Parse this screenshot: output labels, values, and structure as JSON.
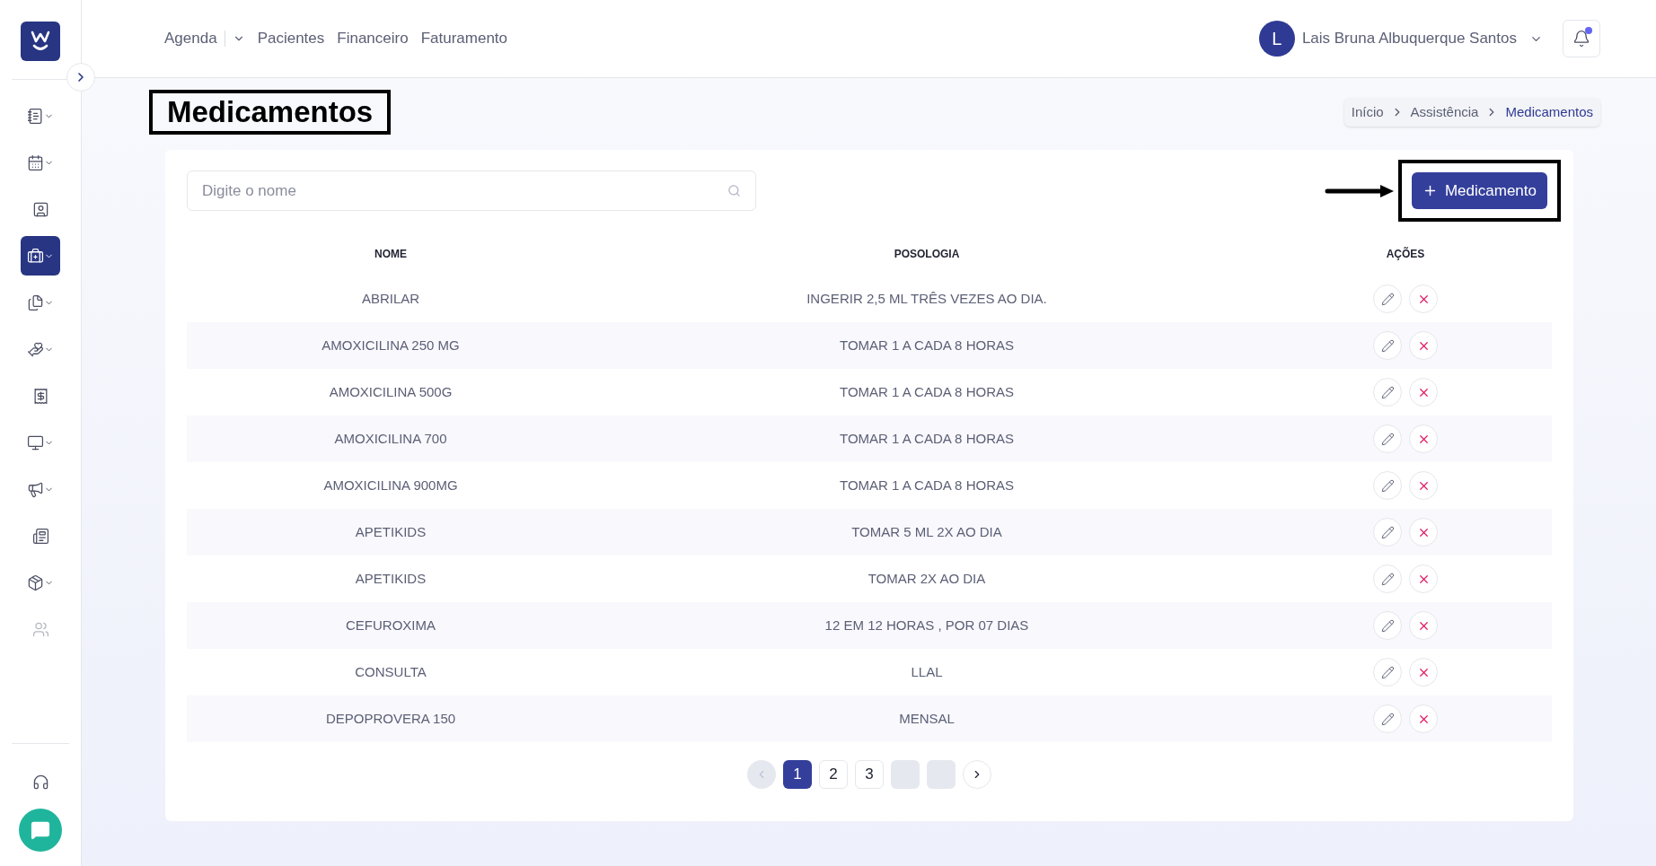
{
  "sidebar": {
    "items": [
      {
        "has_caret": true,
        "selected": false,
        "disabled": false
      },
      {
        "has_caret": true,
        "selected": false,
        "disabled": false
      },
      {
        "has_caret": false,
        "selected": false,
        "disabled": false
      },
      {
        "has_caret": true,
        "selected": true,
        "disabled": false
      },
      {
        "has_caret": true,
        "selected": false,
        "disabled": false
      },
      {
        "has_caret": true,
        "selected": false,
        "disabled": false
      },
      {
        "has_caret": false,
        "selected": false,
        "disabled": false
      },
      {
        "has_caret": true,
        "selected": false,
        "disabled": false
      },
      {
        "has_caret": true,
        "selected": false,
        "disabled": false
      },
      {
        "has_caret": false,
        "selected": false,
        "disabled": false
      },
      {
        "has_caret": true,
        "selected": false,
        "disabled": false
      },
      {
        "has_caret": false,
        "selected": false,
        "disabled": true
      }
    ]
  },
  "topbar": {
    "nav": [
      {
        "label": "Agenda",
        "has_dropdown": true
      },
      {
        "label": "Pacientes",
        "has_dropdown": false
      },
      {
        "label": "Financeiro",
        "has_dropdown": false
      },
      {
        "label": "Faturamento",
        "has_dropdown": false
      }
    ],
    "user": {
      "initial": "L",
      "name": "Lais Bruna Albuquerque Santos"
    },
    "notifications": {
      "unread": true
    }
  },
  "page": {
    "title": "Medicamentos",
    "breadcrumb": [
      {
        "label": "Início",
        "selected": false
      },
      {
        "label": "Assistência",
        "selected": false
      },
      {
        "label": "Medicamentos",
        "selected": true
      }
    ]
  },
  "search": {
    "placeholder": "Digite o nome"
  },
  "add_button": "Medicamento",
  "table": {
    "columns": [
      "NOME",
      "POSOLOGIA",
      "AÇÕES"
    ],
    "rows": [
      {
        "nome": "ABRILAR",
        "posologia": "INGERIR 2,5 ML TRÊS VEZES AO DIA."
      },
      {
        "nome": "AMOXICILINA 250 MG",
        "posologia": "TOMAR 1 A CADA 8 HORAS"
      },
      {
        "nome": "AMOXICILINA 500G",
        "posologia": "TOMAR 1 A CADA 8 HORAS"
      },
      {
        "nome": "AMOXICILINA 700",
        "posologia": "TOMAR 1 A CADA 8 HORAS"
      },
      {
        "nome": "AMOXICILINA 900MG",
        "posologia": "TOMAR 1 A CADA 8 HORAS"
      },
      {
        "nome": "APETIKIDS",
        "posologia": "TOMAR 5 ML 2X AO DIA"
      },
      {
        "nome": "APETIKIDS",
        "posologia": "TOMAR 2X AO DIA"
      },
      {
        "nome": "CEFUROXIMA",
        "posologia": "12 EM 12 HORAS , POR 07 DIAS"
      },
      {
        "nome": "CONSULTA",
        "posologia": "LLAL"
      },
      {
        "nome": "DEPOPROVERA 150",
        "posologia": "MENSAL"
      }
    ]
  },
  "pagination": {
    "prev_disabled": true,
    "pages": [
      {
        "kind": "page",
        "label": "1",
        "selected": true
      },
      {
        "kind": "page",
        "label": "2",
        "selected": false
      },
      {
        "kind": "page",
        "label": "3",
        "selected": false
      },
      {
        "kind": "blank",
        "selected": false
      },
      {
        "kind": "blank",
        "selected": false
      }
    ]
  }
}
